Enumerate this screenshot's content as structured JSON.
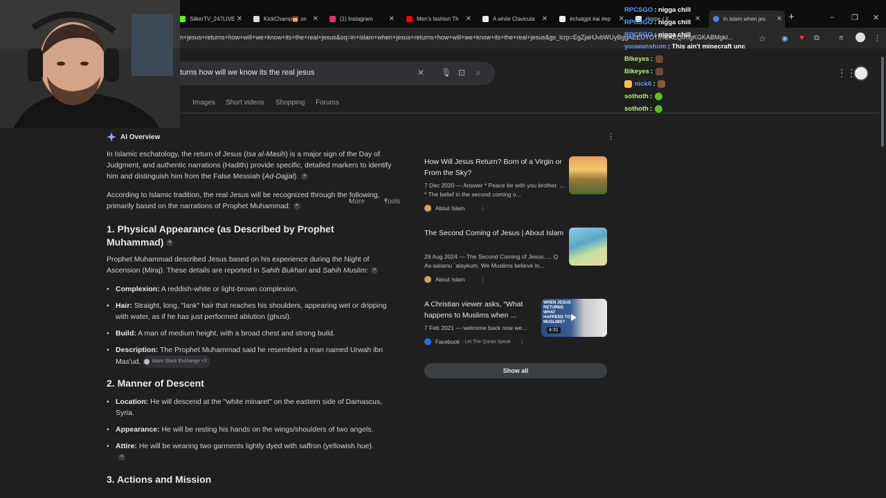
{
  "browser": {
    "tabs": [
      {
        "label": "SlikerTV_247LIVE",
        "color": "#53fc18"
      },
      {
        "label": "KickChamp👑 on",
        "color": "#ffffff"
      },
      {
        "label": "(1) Instagram",
        "color": "#e1306c"
      },
      {
        "label": "Men's fashion Th",
        "color": "#ff0000"
      },
      {
        "label": "A white Clavicula",
        "color": "#ffffff"
      },
      {
        "label": "#chatgpt #ai #ep",
        "color": "#ffffff"
      },
      {
        "label": "Home / X",
        "color": "#ffffff"
      },
      {
        "label": "in islam when jes",
        "color": "#4285f4"
      }
    ],
    "url": "n+jesus+returns+how+will+we+know+its+the+real+jesus&oq=in+islam+when+jesus+returns+how+will+we+know+its+the+real+jesus&gs_lcrp=EgZjaHJvbWUyBggAEEUYOTIHCAEQIRigKGKABMgkI..."
  },
  "search": {
    "query": "turns how will we know its the real jesus",
    "tabs": [
      "Images",
      "Short videos",
      "Shopping",
      "Forums",
      "More",
      "Tools"
    ]
  },
  "overview": {
    "label": "AI Overview",
    "intro_1a": "In Islamic eschatology, the return of Jesus (",
    "intro_1b": "Isa al-Masih",
    "intro_1c": ") is a major sign of the Day of Judgment, and authentic narrations (Hadith) provide specific, detailed markers to identify him and distinguish him from the False Messiah (",
    "intro_1d": "Ad-Dajjal",
    "intro_1e": ").",
    "intro_2": "According to Islamic tradition, the real Jesus will be recognized through the following, primarily based on the narrations of Prophet Muhammad:",
    "h1": "1. Physical Appearance (as Described by Prophet Muhammad)",
    "h1_para_a": "Prophet Muhammad described Jesus based on his experience during the Night of Ascension (Miraj). These details are reported in ",
    "h1_para_b": "Sahih Bukhari",
    "h1_para_c": " and ",
    "h1_para_d": "Sahih Muslim",
    "h1_para_e": ":",
    "items1": [
      {
        "k": "Complexion:",
        "v": " A reddish-white or light-brown complexion."
      },
      {
        "k": "Hair:",
        "v": " Straight, long, \"lank\" hair that reaches his shoulders, appearing wet or dripping with water, as if he has just performed ablution (ghusl)."
      },
      {
        "k": "Build:",
        "v": " A man of medium height, with a broad chest and strong build."
      },
      {
        "k": "Description:",
        "v": " The Prophet Muhammad said he resembled a man named Urwah ibn Mas'ud."
      }
    ],
    "chip": "Islam Stack Exchange +3",
    "h2": "2. Manner of Descent",
    "items2": [
      {
        "k": "Location:",
        "v": " He will descend at the \"white minaret\" on the eastern side of Damascus, Syria."
      },
      {
        "k": "Appearance:",
        "v": " He will be resting his hands on the wings/shoulders of two angels."
      },
      {
        "k": "Attire:",
        "v": " He will be wearing two garments lightly dyed with saffron (yellowish hue)."
      }
    ],
    "h3": "3. Actions and Mission"
  },
  "sources": [
    {
      "title": "How Will Jesus Return? Born of a Virgin or From the Sky?",
      "snippet": "7 Dec 2020 — Answer * Peace be with you brother. ... * The belief in the second coming o...",
      "site": "About Islam"
    },
    {
      "title": "The Second Coming of Jesus | About Islam",
      "snippet": "28 Aug 2024 — The Second Coming of Jesus. ... Q As-salamu `alaykum. We Muslims believe in...",
      "site": "About Islam"
    },
    {
      "title": "A Christian viewer asks, “What happens to Muslims when ...",
      "snippet": "7 Feb 2021 — welcome back now we...",
      "site": "Facebook",
      "site_sub": "· Let The Quran Speak",
      "duration": "4:31",
      "thumb_text": "WHEN JESUS RETURNS WHAT HAPPENS TO MUSLIMS?"
    }
  ],
  "show_all": "Show all",
  "chat": [
    {
      "user": "RPCSGO",
      "msg": ": nigga chill",
      "color": "#5b9bff"
    },
    {
      "user": "RPCSGO",
      "msg": ": nigga chill",
      "color": "#5b9bff"
    },
    {
      "user": "RPCSGO",
      "msg": ": nigga chill",
      "color": "#5b9bff"
    },
    {
      "user": "youwanshum",
      "msg": ": This ain't minecraft unc",
      "color": "#5b9bff"
    },
    {
      "user": "Blkeyes",
      "msg": ":",
      "color": "#b9f26b"
    },
    {
      "user": "Blkeyes",
      "msg": ":",
      "color": "#b9f26b"
    },
    {
      "user": "nick6",
      "msg": ":",
      "color": "#5b9bff"
    },
    {
      "user": "sothoth",
      "msg": ":",
      "color": "#b9f26b"
    },
    {
      "user": "sothoth",
      "msg": ":",
      "color": "#b9f26b"
    }
  ]
}
